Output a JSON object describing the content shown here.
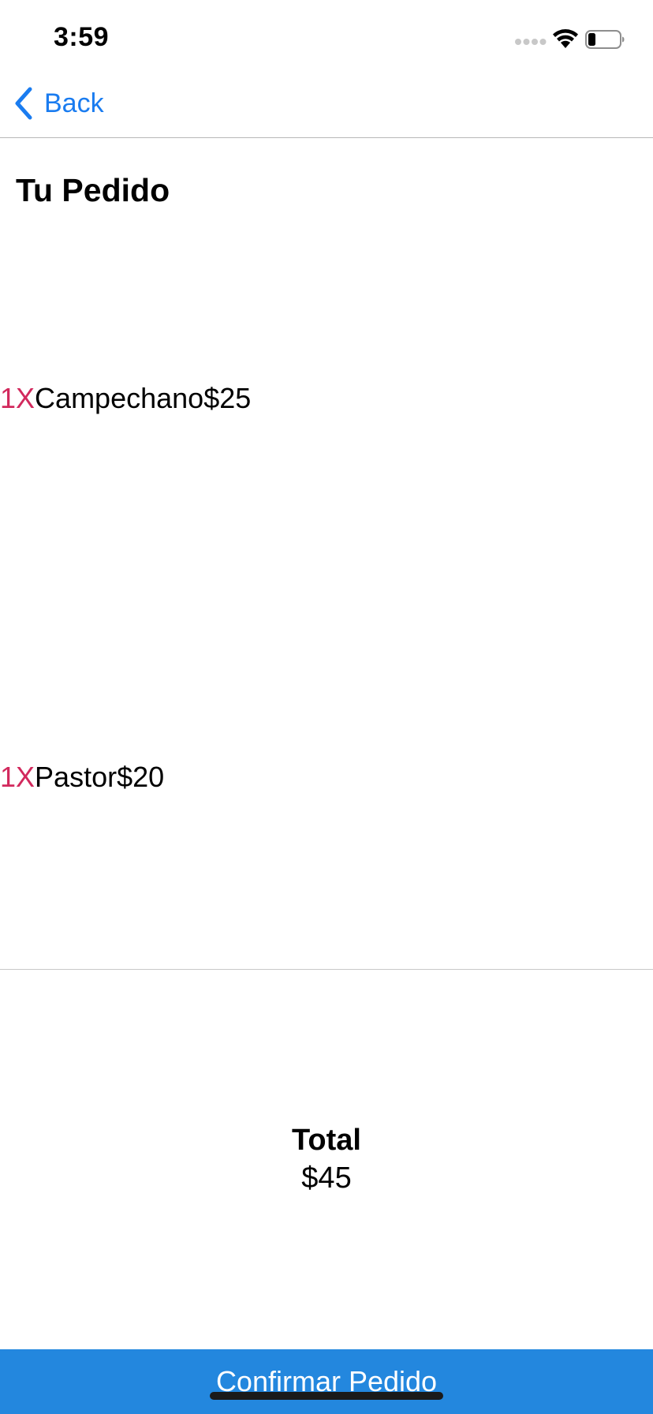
{
  "status_bar": {
    "time": "3:59"
  },
  "nav": {
    "back_label": "Back",
    "accent_color": "#1a7cf0"
  },
  "page": {
    "title": "Tu Pedido"
  },
  "order": {
    "items": [
      {
        "qty": "1X",
        "name": "Campechano",
        "price": "$25"
      },
      {
        "qty": "1X",
        "name": "Pastor",
        "price": "$20"
      }
    ],
    "qty_color": "#d2295d"
  },
  "summary": {
    "total_label": "Total",
    "total_value": "$45"
  },
  "actions": {
    "confirm_label": "Confirmar Pedido",
    "confirm_color": "#2387de"
  },
  "icons": {
    "back": "chevron-left-icon",
    "signal": "cellular-signal-icon",
    "wifi": "wifi-icon",
    "battery": "battery-icon"
  }
}
